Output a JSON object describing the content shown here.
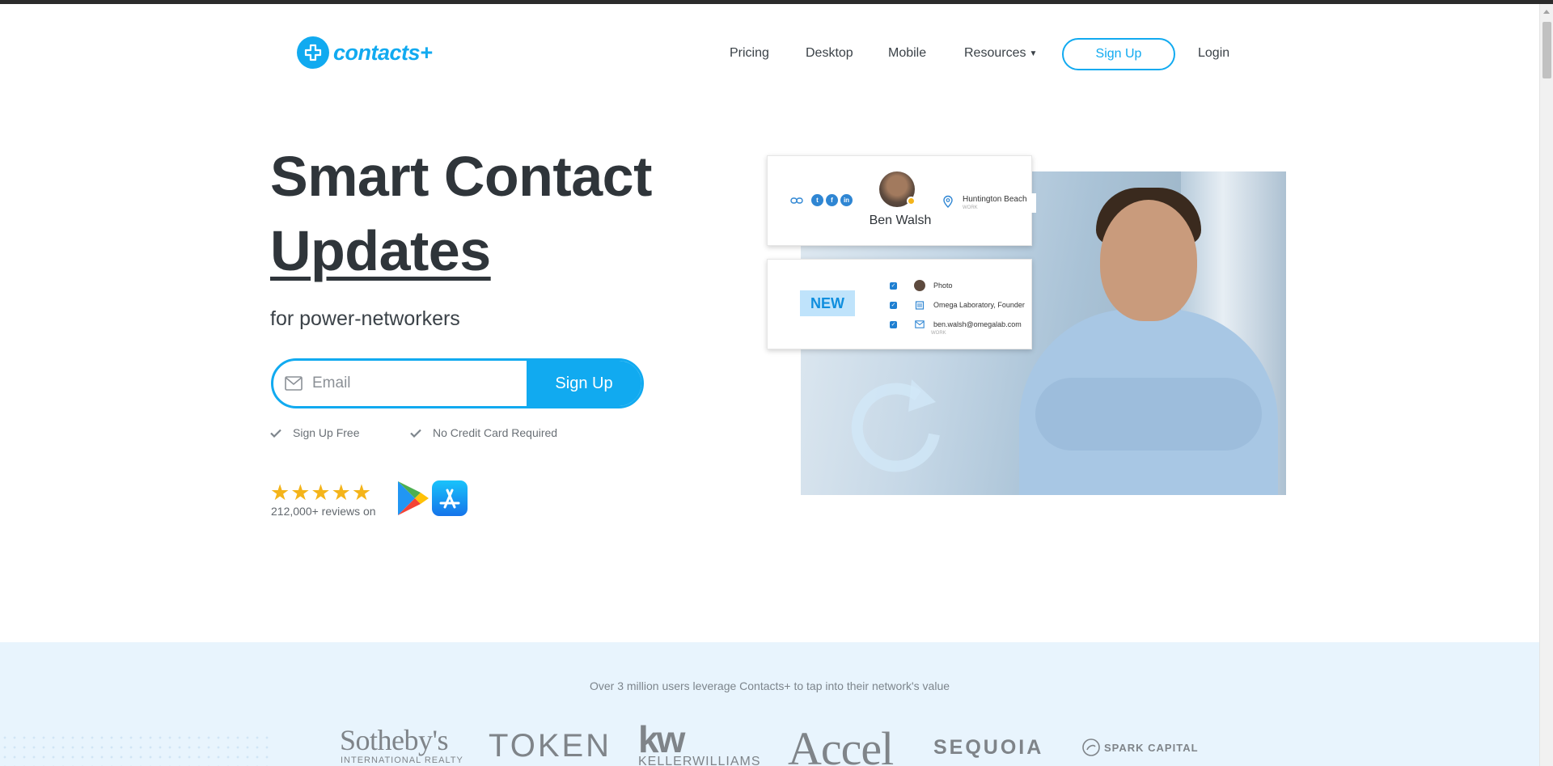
{
  "brand": {
    "name": "contacts+"
  },
  "nav": {
    "pricing": "Pricing",
    "desktop": "Desktop",
    "mobile": "Mobile",
    "resources": "Resources",
    "signup": "Sign Up",
    "login": "Login"
  },
  "hero": {
    "title_line1": "Smart Contact",
    "title_line2": "Updates",
    "subtitle": "for power-networkers",
    "email_placeholder": "Email",
    "signup_button": "Sign Up",
    "perks": [
      "Sign Up Free",
      "No Credit Card Required"
    ],
    "stars": "★★★★★",
    "reviews": "212,000+ reviews on"
  },
  "contact_card": {
    "name": "Ben Walsh",
    "location": "Huntington Beach",
    "location_type": "WORK",
    "new_badge": "NEW",
    "updates": [
      "Photo",
      "Omega Laboratory, Founder",
      "ben.walsh@omegalab.com"
    ],
    "email_type": "WORK"
  },
  "social_proof": {
    "tagline": "Over 3 million users leverage Contacts+ to tap into their network's value",
    "logos": {
      "sothebys": "Sotheby's",
      "sothebys_sub": "INTERNATIONAL REALTY",
      "token": "TOKEN",
      "kw": "kw",
      "kw_sub": "KELLERWILLIAMS",
      "accel": "Accel",
      "sequoia": "SEQUOIA",
      "spark": "SPARK CAPITAL"
    }
  },
  "colors": {
    "accent": "#11aaf0",
    "star": "#f4b41a",
    "band": "#e8f4fd"
  }
}
